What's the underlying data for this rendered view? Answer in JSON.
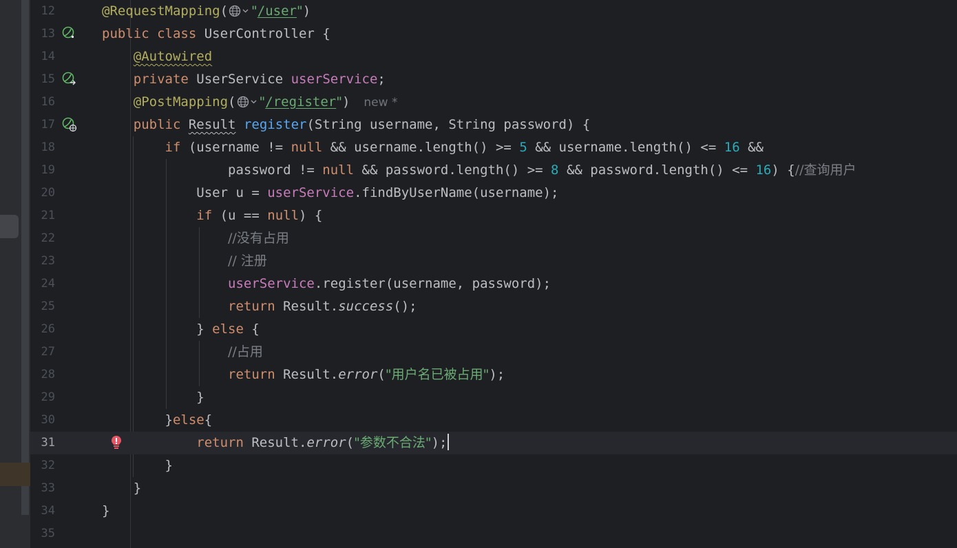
{
  "colors": {
    "background": "#1e1f22",
    "keyword": "#cf8e6d",
    "annotation": "#b3ae60",
    "string": "#6aab73",
    "field": "#c77dbb",
    "method": "#56a8f5",
    "number": "#2aacb8",
    "comment": "#7a7e85",
    "text": "#bcbec4"
  },
  "editor": {
    "current_line": 31,
    "inlay_hint": "new *",
    "icons": {
      "13": "spring-bean-icon",
      "15": "spring-autowired-navigate-icon",
      "17": "spring-web-endpoint-icon",
      "31": "error-bulb-icon"
    },
    "lines": [
      {
        "n": "12",
        "tokens": [
          [
            "ann",
            "@RequestMapping"
          ],
          [
            "plain",
            "("
          ],
          [
            "globe",
            ""
          ],
          [
            "str",
            "\""
          ],
          [
            "url",
            "/user"
          ],
          [
            "str",
            "\""
          ],
          [
            "plain",
            ")"
          ]
        ]
      },
      {
        "n": "13",
        "tokens": [
          [
            "kw",
            "public class "
          ],
          [
            "plain",
            "UserController {"
          ]
        ]
      },
      {
        "n": "14",
        "tokens": [
          [
            "plain",
            "    "
          ],
          [
            "annwavy",
            "@Autowired"
          ]
        ]
      },
      {
        "n": "15",
        "tokens": [
          [
            "plain",
            "    "
          ],
          [
            "kw",
            "private "
          ],
          [
            "plain",
            "UserService "
          ],
          [
            "field",
            "userService"
          ],
          [
            "plain",
            ";"
          ]
        ]
      },
      {
        "n": "16",
        "tokens": [
          [
            "plain",
            "    "
          ],
          [
            "ann",
            "@PostMapping"
          ],
          [
            "plain",
            "("
          ],
          [
            "globe",
            ""
          ],
          [
            "str",
            "\""
          ],
          [
            "url",
            "/register"
          ],
          [
            "str",
            "\""
          ],
          [
            "plain",
            ")"
          ],
          [
            "hint",
            "new *"
          ]
        ]
      },
      {
        "n": "17",
        "tokens": [
          [
            "plain",
            "    "
          ],
          [
            "kw",
            "public "
          ],
          [
            "under",
            "Result"
          ],
          [
            "plain",
            " "
          ],
          [
            "method",
            "register"
          ],
          [
            "plain",
            "(String username, String password) {"
          ]
        ]
      },
      {
        "n": "18",
        "tokens": [
          [
            "plain",
            "        "
          ],
          [
            "kw",
            "if "
          ],
          [
            "plain",
            "(username != "
          ],
          [
            "kw",
            "null "
          ],
          [
            "plain",
            "&& username.length() >= "
          ],
          [
            "num",
            "5"
          ],
          [
            "plain",
            " && username.length() <= "
          ],
          [
            "num",
            "16"
          ],
          [
            "plain",
            " &&"
          ]
        ]
      },
      {
        "n": "19",
        "tokens": [
          [
            "plain",
            "                password != "
          ],
          [
            "kw",
            "null "
          ],
          [
            "plain",
            "&& password.length() >= "
          ],
          [
            "num",
            "8"
          ],
          [
            "plain",
            " && password.length() <= "
          ],
          [
            "num",
            "16"
          ],
          [
            "plain",
            ") {"
          ],
          [
            "comment",
            "//查询用户"
          ]
        ]
      },
      {
        "n": "20",
        "tokens": [
          [
            "plain",
            "            User u = "
          ],
          [
            "field",
            "userService"
          ],
          [
            "plain",
            ".findByUserName(username);"
          ]
        ]
      },
      {
        "n": "21",
        "tokens": [
          [
            "plain",
            "            "
          ],
          [
            "kw",
            "if "
          ],
          [
            "plain",
            "(u == "
          ],
          [
            "kw",
            "null"
          ],
          [
            "plain",
            ") {"
          ]
        ]
      },
      {
        "n": "22",
        "tokens": [
          [
            "plain",
            "                "
          ],
          [
            "comment",
            "//没有占用"
          ]
        ]
      },
      {
        "n": "23",
        "tokens": [
          [
            "plain",
            "                "
          ],
          [
            "comment",
            "// 注册"
          ]
        ]
      },
      {
        "n": "24",
        "tokens": [
          [
            "plain",
            "                "
          ],
          [
            "field",
            "userService"
          ],
          [
            "plain",
            ".register(username, password);"
          ]
        ]
      },
      {
        "n": "25",
        "tokens": [
          [
            "plain",
            "                "
          ],
          [
            "kw",
            "return "
          ],
          [
            "plain",
            "Result."
          ],
          [
            "italic",
            "success"
          ],
          [
            "plain",
            "();"
          ]
        ]
      },
      {
        "n": "26",
        "tokens": [
          [
            "plain",
            "            } "
          ],
          [
            "kw",
            "else "
          ],
          [
            "plain",
            "{"
          ]
        ]
      },
      {
        "n": "27",
        "tokens": [
          [
            "plain",
            "                "
          ],
          [
            "comment",
            "//占用"
          ]
        ]
      },
      {
        "n": "28",
        "tokens": [
          [
            "plain",
            "                "
          ],
          [
            "kw",
            "return "
          ],
          [
            "plain",
            "Result."
          ],
          [
            "italic",
            "error"
          ],
          [
            "plain",
            "("
          ],
          [
            "str",
            "\"用户名已被占用\""
          ],
          [
            "plain",
            ");"
          ]
        ]
      },
      {
        "n": "29",
        "tokens": [
          [
            "plain",
            "            }"
          ]
        ]
      },
      {
        "n": "30",
        "tokens": [
          [
            "plain",
            "        }"
          ],
          [
            "kw",
            "else"
          ],
          [
            "plain",
            "{"
          ]
        ]
      },
      {
        "n": "31",
        "tokens": [
          [
            "plain",
            "            "
          ],
          [
            "kw",
            "return "
          ],
          [
            "plain",
            "Result."
          ],
          [
            "italic",
            "error"
          ],
          [
            "plain",
            "("
          ],
          [
            "str",
            "\"参数不合法\""
          ],
          [
            "plain",
            ");"
          ],
          [
            "caret",
            ""
          ]
        ]
      },
      {
        "n": "32",
        "tokens": [
          [
            "plain",
            "        }"
          ]
        ]
      },
      {
        "n": "33",
        "tokens": [
          [
            "plain",
            "    }"
          ]
        ]
      },
      {
        "n": "34",
        "tokens": [
          [
            "plain",
            "}"
          ]
        ]
      },
      {
        "n": "35",
        "tokens": []
      }
    ]
  }
}
